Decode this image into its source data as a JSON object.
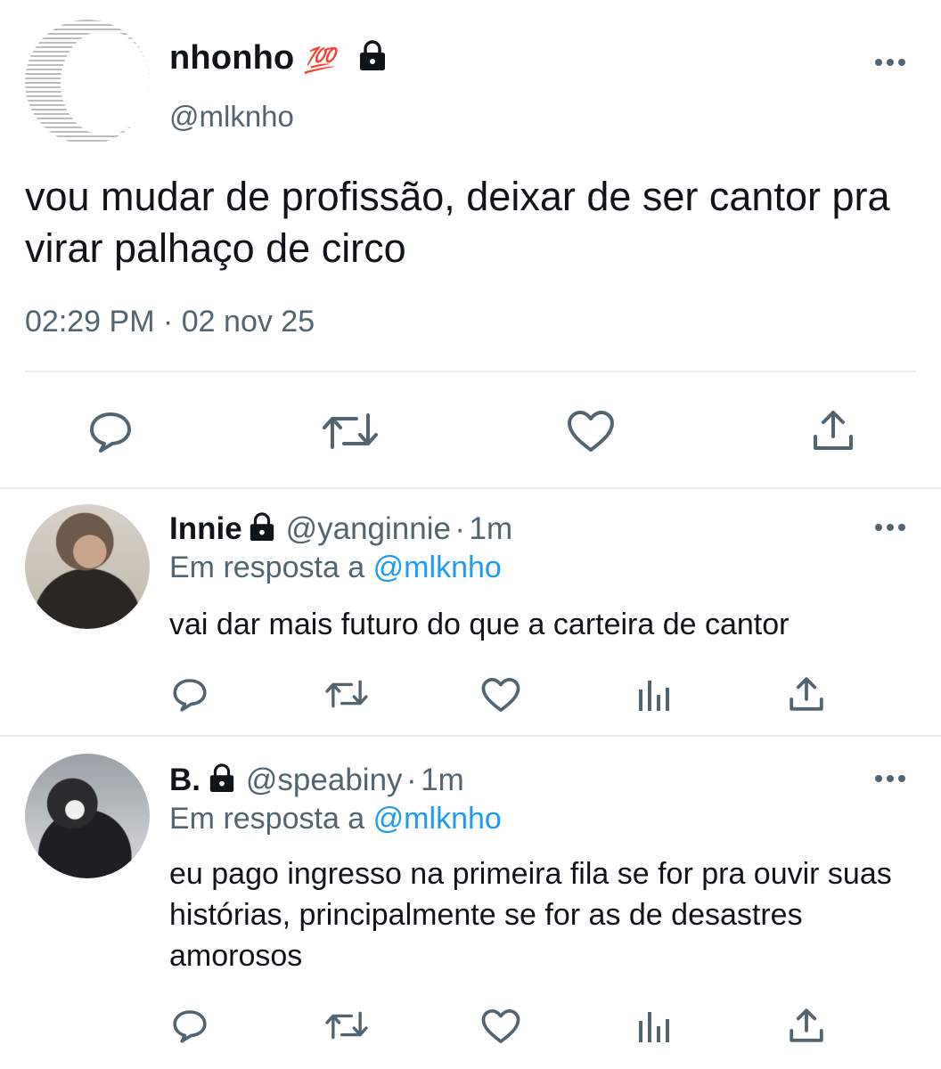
{
  "main_tweet": {
    "name": "nhonho",
    "name_emoji": "💯",
    "handle": "@mlknho",
    "text": "vou mudar de profissão, deixar de ser cantor pra virar palhaço de circo",
    "time": "02:29 PM",
    "date": "02 nov 25"
  },
  "replies": [
    {
      "name": "Innie",
      "handle": "@yanginnie",
      "age": "1m",
      "replying_prefix": "Em resposta a",
      "replying_to": "@mlknho",
      "text": "vai dar mais futuro do que a carteira de cantor"
    },
    {
      "name": "B.",
      "handle": "@speabiny",
      "age": "1m",
      "replying_prefix": "Em resposta a",
      "replying_to": "@mlknho",
      "text": "eu pago ingresso na primeira fila se for pra ouvir suas histórias, principalmente se for as de desastres amorosos"
    }
  ],
  "icons": {
    "reply": "comment-icon",
    "retweet": "retweet-icon",
    "like": "heart-icon",
    "analytics": "analytics-icon",
    "share": "share-icon",
    "more": "more-icon",
    "lock": "lock-icon"
  },
  "colors": {
    "text": "#0f1419",
    "muted": "#536471",
    "link": "#1d9bf0",
    "divider": "#e6ecf0"
  }
}
